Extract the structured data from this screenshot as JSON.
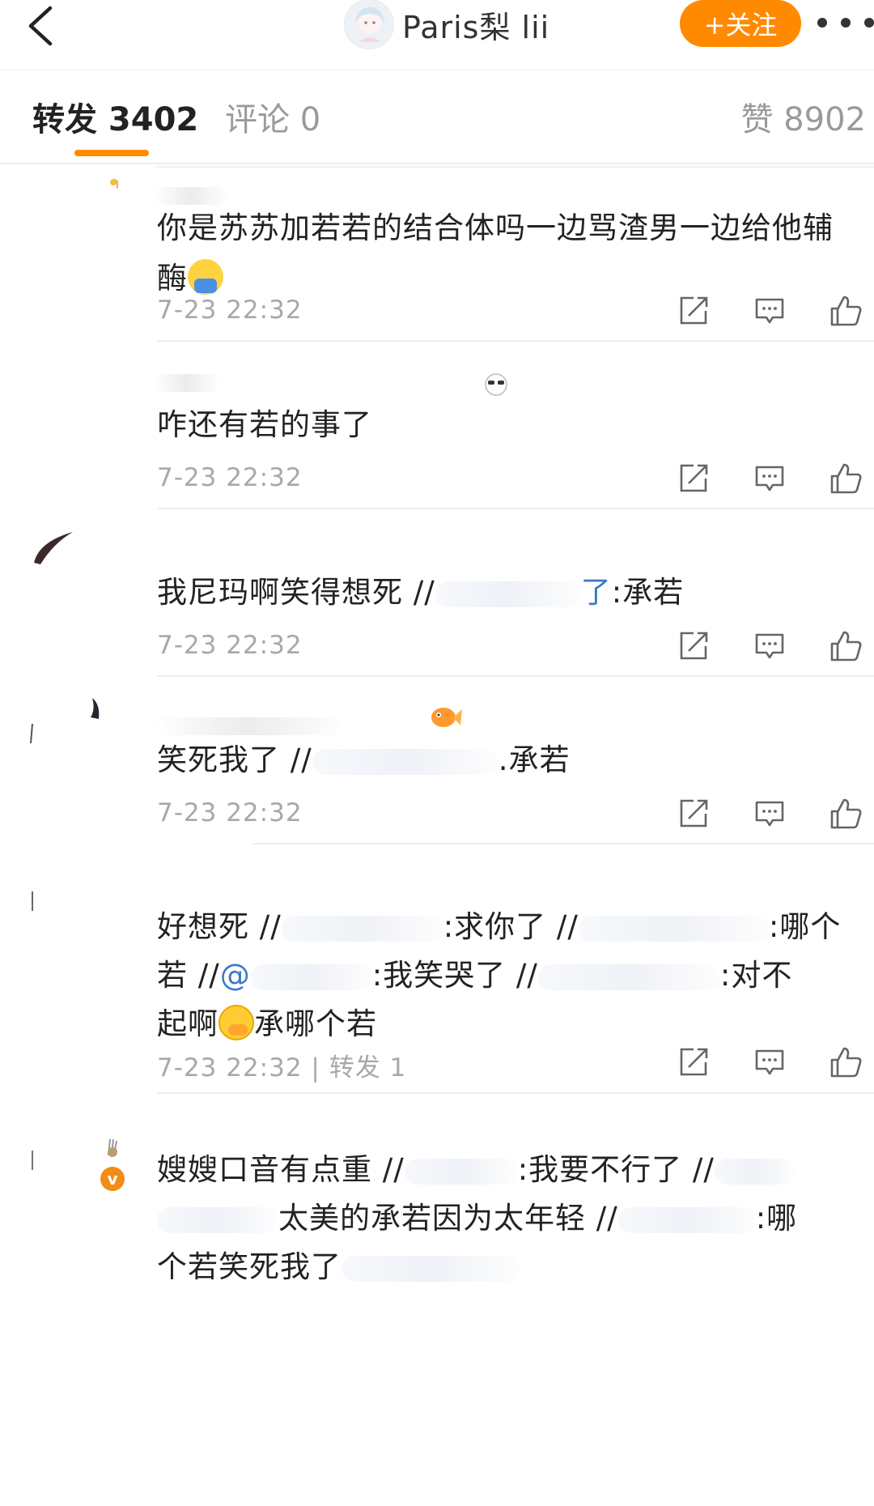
{
  "header": {
    "user_name": "Paris梨 lii",
    "follow_label": "+关注"
  },
  "tabs": {
    "repost": "转发 3402",
    "comment": "评论 0",
    "like": "赞 8902"
  },
  "reposts": [
    {
      "text": "你是苏苏加若若的结合体吗一边骂渣男一边给他辅酶",
      "time": "7-23 22:32"
    },
    {
      "text": "咋还有若的事了",
      "time": "7-23 22:32"
    },
    {
      "text_a": "我尼玛啊笑得想死 //",
      "mention_tail": "了",
      "text_b": ":承若",
      "time": "7-23 22:32"
    },
    {
      "text_a": "笑死我了 //",
      "text_b": ".承若",
      "time": "7-23 22:32"
    },
    {
      "line1_a": "好想死 //",
      "line1_b": ":求你了 //",
      "line1_c": ":哪个",
      "line2_a": "若 //",
      "line2_at": "@",
      "line2_b": ":我笑哭了 //",
      "line2_c": ":对不",
      "line3_a": "起啊",
      "line3_b": "承哪个若",
      "time": "7-23 22:32",
      "repost_count": "| 转发 1"
    },
    {
      "line1_a": "嫂嫂口音有点重 //",
      "line1_b": ":我要不行了 //",
      "line2_a": "太美的承若因为太年轻 //",
      "line2_b": ":哪",
      "line3_a": "个若笑死我了"
    }
  ]
}
